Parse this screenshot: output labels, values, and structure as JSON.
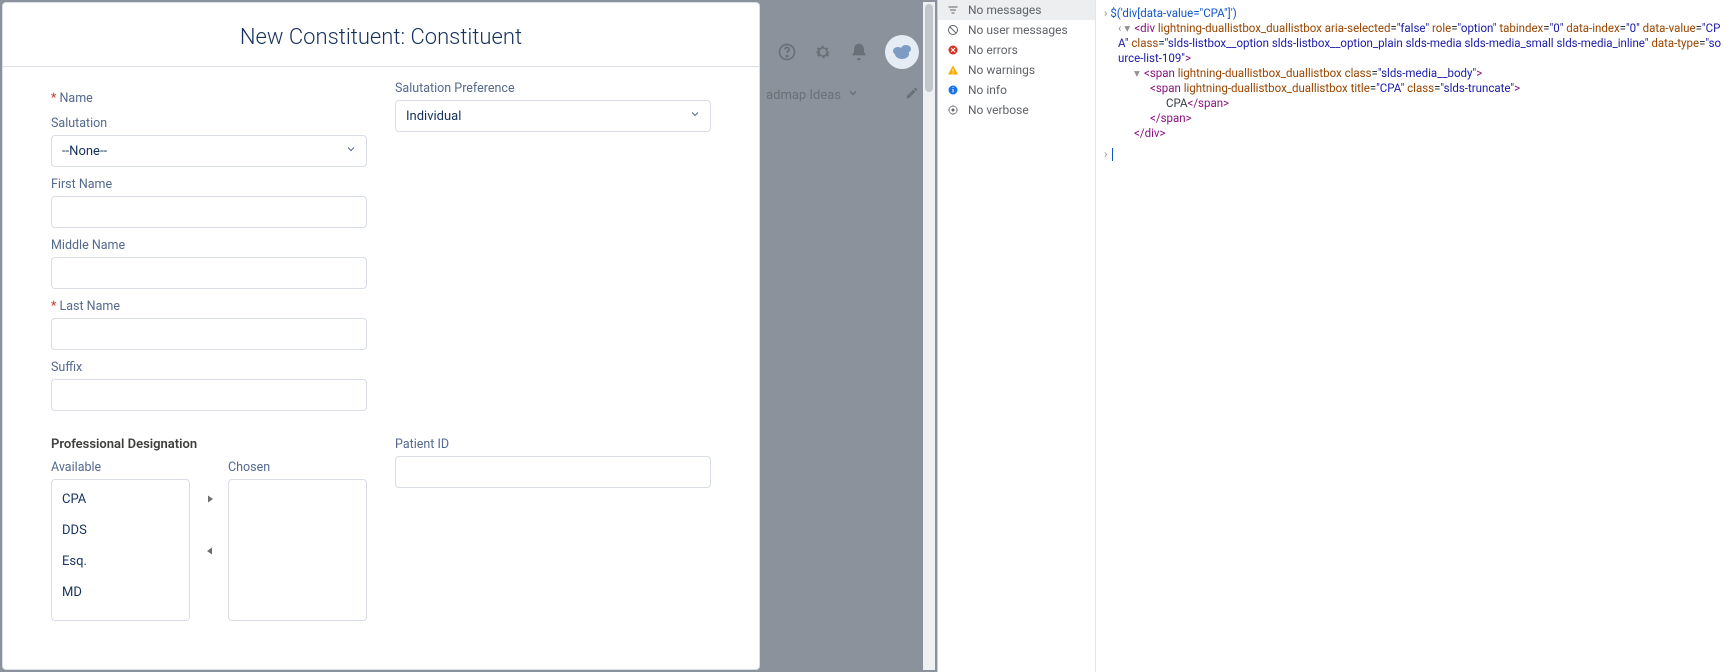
{
  "modal": {
    "title": "New Constituent: Constituent",
    "name_section_label": "Name",
    "salutation_label": "Salutation",
    "salutation_value": "--None--",
    "first_name_label": "First Name",
    "middle_name_label": "Middle Name",
    "last_name_label": "Last Name",
    "suffix_label": "Suffix",
    "salutation_pref_label": "Salutation Preference",
    "salutation_pref_value": "Individual",
    "prof_designation_label": "Professional Designation",
    "available_label": "Available",
    "chosen_label": "Chosen",
    "patient_id_label": "Patient ID",
    "available_options": [
      "CPA",
      "DDS",
      "Esq.",
      "MD"
    ]
  },
  "sf_bg": {
    "tab_label": "admap Ideas"
  },
  "devtools": {
    "sidebar": [
      {
        "icon": "filter",
        "label": "No messages"
      },
      {
        "icon": "no-user",
        "label": "No user messages"
      },
      {
        "icon": "error",
        "label": "No errors"
      },
      {
        "icon": "warn",
        "label": "No warnings"
      },
      {
        "icon": "info",
        "label": "No info"
      },
      {
        "icon": "verbose",
        "label": "No verbose"
      }
    ],
    "selected_sidebar": 0,
    "console_cmd": "$('div[data-value=\"CPA\"]')",
    "dom_out": {
      "line1_pre": "<div ",
      "line1_attrs": [
        {
          "n": "lightning-duallistbox_duallistbox",
          "v": null
        },
        {
          "n": "aria-selected",
          "v": "false"
        },
        {
          "n": "role",
          "v": "option"
        },
        {
          "n": "tabindex",
          "v": "0"
        },
        {
          "n": "data-index",
          "v": "0"
        },
        {
          "n": "data-value",
          "v": "CPA"
        },
        {
          "n": "class",
          "v": "slds-listbox__option slds-listbox__option_plain slds-media slds-media_small slds-media_inline"
        },
        {
          "n": "data-type",
          "v": "source-list-109"
        }
      ],
      "span1_attrs": [
        {
          "n": "lightning-duallistbox_duallistbox",
          "v": null
        },
        {
          "n": "class",
          "v": "slds-media__body"
        }
      ],
      "span2_attrs": [
        {
          "n": "lightning-duallistbox_duallistbox",
          "v": null
        },
        {
          "n": "title",
          "v": "CPA"
        },
        {
          "n": "class",
          "v": "slds-truncate"
        }
      ],
      "inner_text": "CPA"
    }
  }
}
